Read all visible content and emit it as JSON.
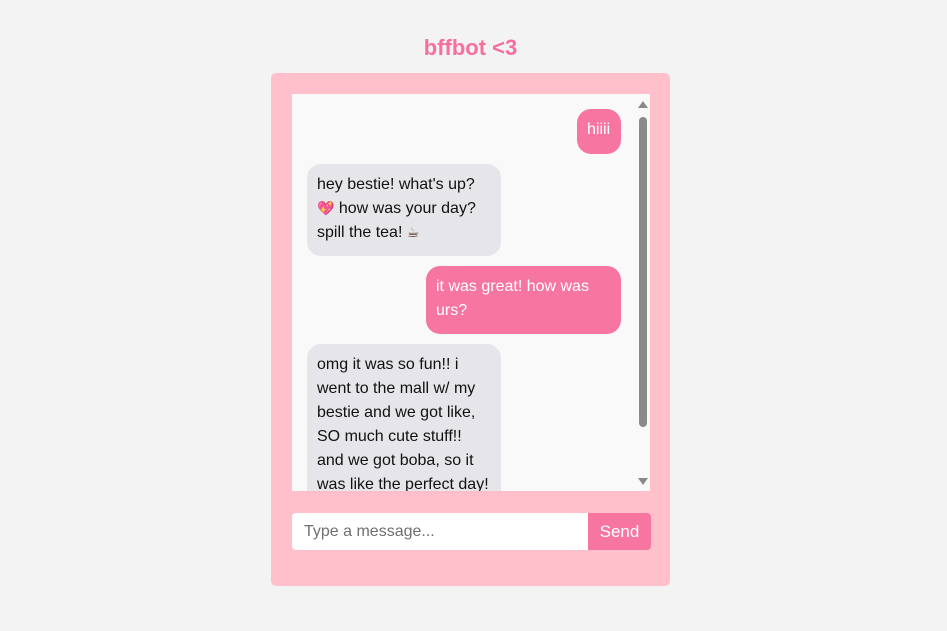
{
  "app": {
    "title": "bffbot <3"
  },
  "colors": {
    "accent": "#f776a1",
    "panel": "#ffc0cb",
    "bot_bubble": "#e5e5ea",
    "background": "#f3f3f3"
  },
  "messages": [
    {
      "sender": "user",
      "text": "hiiii"
    },
    {
      "sender": "bot",
      "text_a": "hey bestie! what's up?",
      "emoji_a": "💖",
      "text_b": " how was your day? spill the tea! ",
      "emoji_b": "☕"
    },
    {
      "sender": "user",
      "text": "it was great! how was urs?"
    },
    {
      "sender": "bot",
      "text": "omg it was so fun!! i went to the mall w/ my bestie and we got like, SO much cute stuff!! and we got boba, so it was like the perfect day!"
    }
  ],
  "composer": {
    "placeholder": "Type a message...",
    "value": "",
    "send_label": "Send"
  }
}
